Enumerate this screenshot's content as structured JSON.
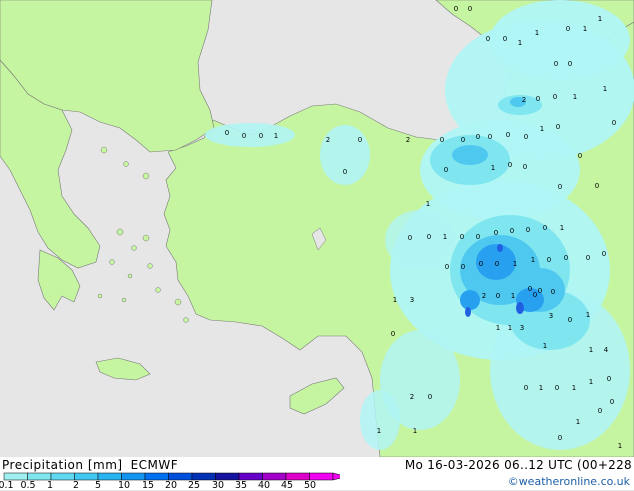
{
  "legend": {
    "title": "Precipitation [mm]",
    "model": "ECMWF",
    "ticks": [
      "0.1",
      "0.5",
      "1",
      "2",
      "5",
      "10",
      "15",
      "20",
      "25",
      "30",
      "35",
      "40",
      "45",
      "50"
    ],
    "colors": [
      "#a0f0f0",
      "#80e6f0",
      "#60d8f0",
      "#40c8f0",
      "#28b4f0",
      "#1496f0",
      "#0070f0",
      "#0050dc",
      "#0030b4",
      "#1414a0",
      "#6400c8",
      "#a000c8",
      "#dc00c8",
      "#f000f0"
    ]
  },
  "valid_time": "Mo 16-03-2026 06..12 UTC (00+228",
  "credit": "©weatheronline.co.uk",
  "colors": {
    "sea": "#e6e6e6",
    "land": "#c5f5a0",
    "rain_light": "#b0f5f5",
    "rain_moderate": "#7fe6f0",
    "rain_heavy": "#4fc8f0",
    "rain_very_heavy": "#28a0f0",
    "rain_peak": "#2060e0"
  },
  "map_labels": [
    {
      "text": "0",
      "lon_lat": "0"
    }
  ],
  "point_values": [
    "0",
    "0",
    "0",
    "0",
    "1",
    "1",
    "0",
    "1",
    "1",
    "0",
    "0",
    "1",
    "0",
    "0",
    "1",
    "2",
    "0",
    "0",
    "0",
    "1",
    "0",
    "0",
    "0",
    "0",
    "0",
    "1",
    "0",
    "0",
    "0",
    "1",
    "0",
    "0",
    "0",
    "1",
    "2",
    "0",
    "0",
    "2",
    "0",
    "0",
    "0",
    "0",
    "0",
    "1",
    "0",
    "0",
    "0",
    "0",
    "0",
    "0",
    "1",
    "0",
    "0",
    "0",
    "0",
    "1",
    "1",
    "0",
    "0",
    "0",
    "0",
    "0",
    "0",
    "0",
    "2",
    "0",
    "1",
    "0",
    "3",
    "0",
    "1",
    "1",
    "3",
    "0",
    "1",
    "1",
    "3",
    "1",
    "1",
    "4",
    "0",
    "1",
    "0",
    "1",
    "1",
    "0",
    "2",
    "0",
    "1",
    "1",
    "1",
    "0",
    "0",
    "0",
    "1",
    "0",
    "0",
    "0",
    "0",
    "1",
    "0",
    "0",
    "1",
    "0",
    "1",
    "0"
  ]
}
